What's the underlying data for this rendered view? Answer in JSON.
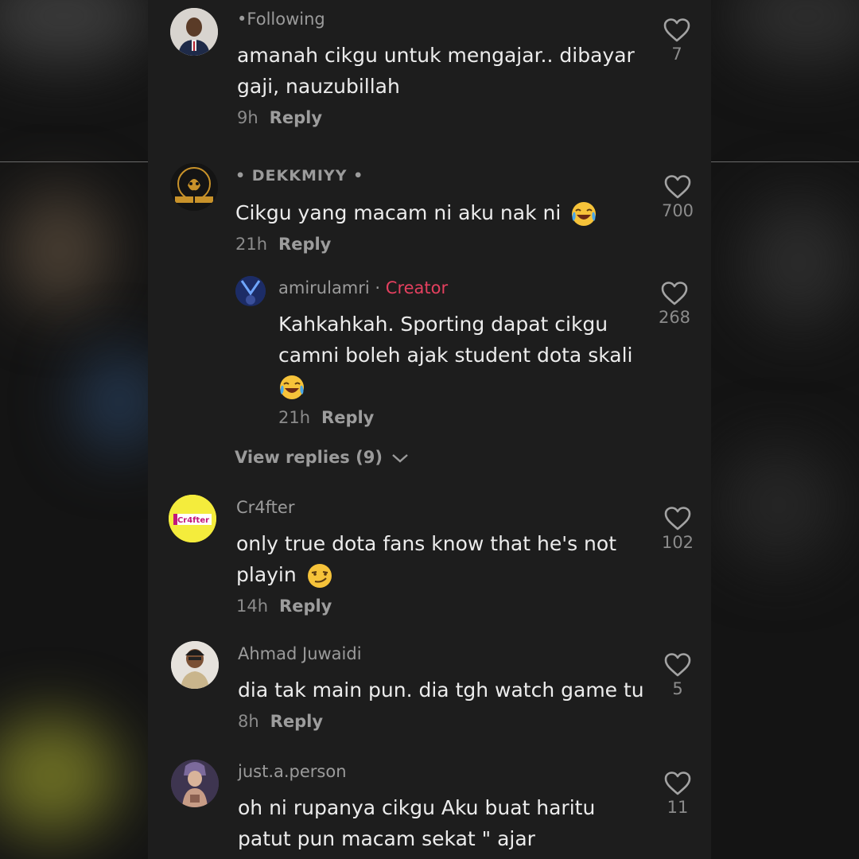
{
  "comments": [
    {
      "username": "•Following",
      "text": "amanah cikgu untuk mengajar.. dibayar gaji, nauzubillah",
      "time": "9h",
      "reply_label": "Reply",
      "likes": "7"
    },
    {
      "username": "• DEKKMIYY •",
      "text": "Cikgu yang macam ni aku nak ni",
      "emoji": "laughing-tears",
      "time": "21h",
      "reply_label": "Reply",
      "likes": "700",
      "reply": {
        "username": "amirulamri",
        "separator": "·",
        "badge": "Creator",
        "text": "Kahkahkah. Sporting dapat cikgu camni boleh ajak student dota skali",
        "emoji": "laughing-tears",
        "time": "21h",
        "reply_label": "Reply",
        "likes": "268"
      },
      "view_replies": "View replies (9)"
    },
    {
      "username": "Cr4fter",
      "avatar_text": "Cr4fter",
      "text": "only true dota fans know that he's not playin",
      "emoji": "smirk",
      "time": "14h",
      "reply_label": "Reply",
      "likes": "102"
    },
    {
      "username": "Ahmad Juwaidi",
      "text": "dia tak main pun. dia tgh watch game tu",
      "time": "8h",
      "reply_label": "Reply",
      "likes": "5"
    },
    {
      "username": "just.a.person",
      "text": "oh ni rupanya cikgu Aku buat haritu patut pun macam sekat \" ajar",
      "likes": "11"
    }
  ],
  "colors": {
    "panel": "#1d1d1d",
    "text": "#ececec",
    "muted": "#8b8b8b",
    "creator": "#e4405f",
    "crafter_avatar": "#f4ec3c"
  }
}
